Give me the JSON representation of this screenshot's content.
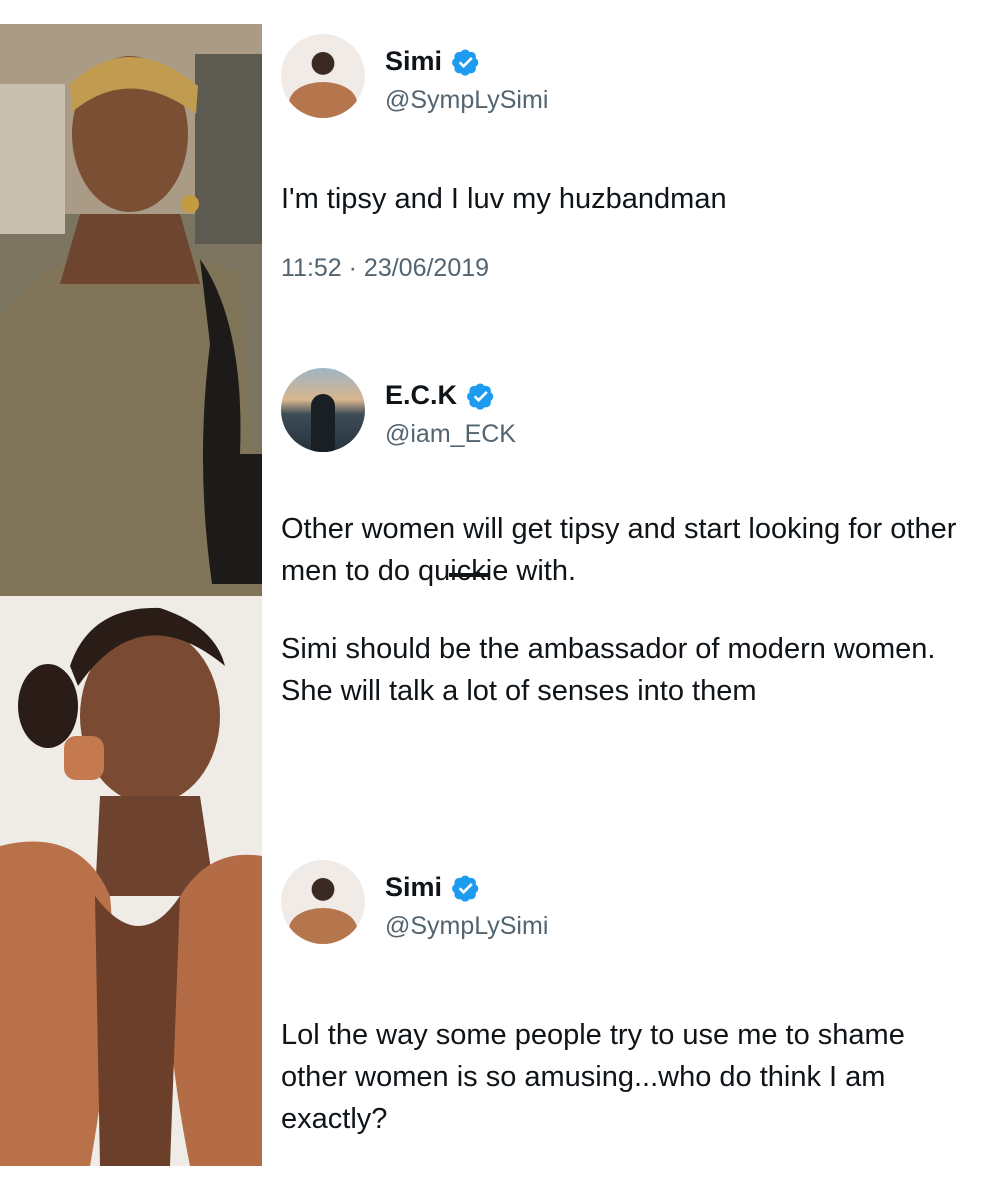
{
  "tweets": [
    {
      "name": "Simi",
      "handle": "@SympLySimi",
      "text": "I'm tipsy and I luv my huzbandman",
      "timestamp": "11:52 · 23/06/2019",
      "verified": true
    },
    {
      "name": "E.C.K",
      "handle": "@iam_ECK",
      "paragraph1_before": "Other women will get tipsy and start looking for other men to do qu",
      "paragraph1_struck": "ick",
      "paragraph1_after": "ie with.",
      "paragraph2": "Simi should be the ambassador of modern women. She will talk a lot of senses into them",
      "verified": true
    },
    {
      "name": "Simi",
      "handle": "@SympLySimi",
      "text": "Lol the way some people try to use me to shame other women is so amusing...who do think I am exactly?",
      "verified": true
    }
  ],
  "colors": {
    "verified_badge": "#1d9bf0",
    "handle_text": "#536471",
    "body_text": "#0f1419"
  },
  "icons": [
    "verified-badge-icon"
  ]
}
